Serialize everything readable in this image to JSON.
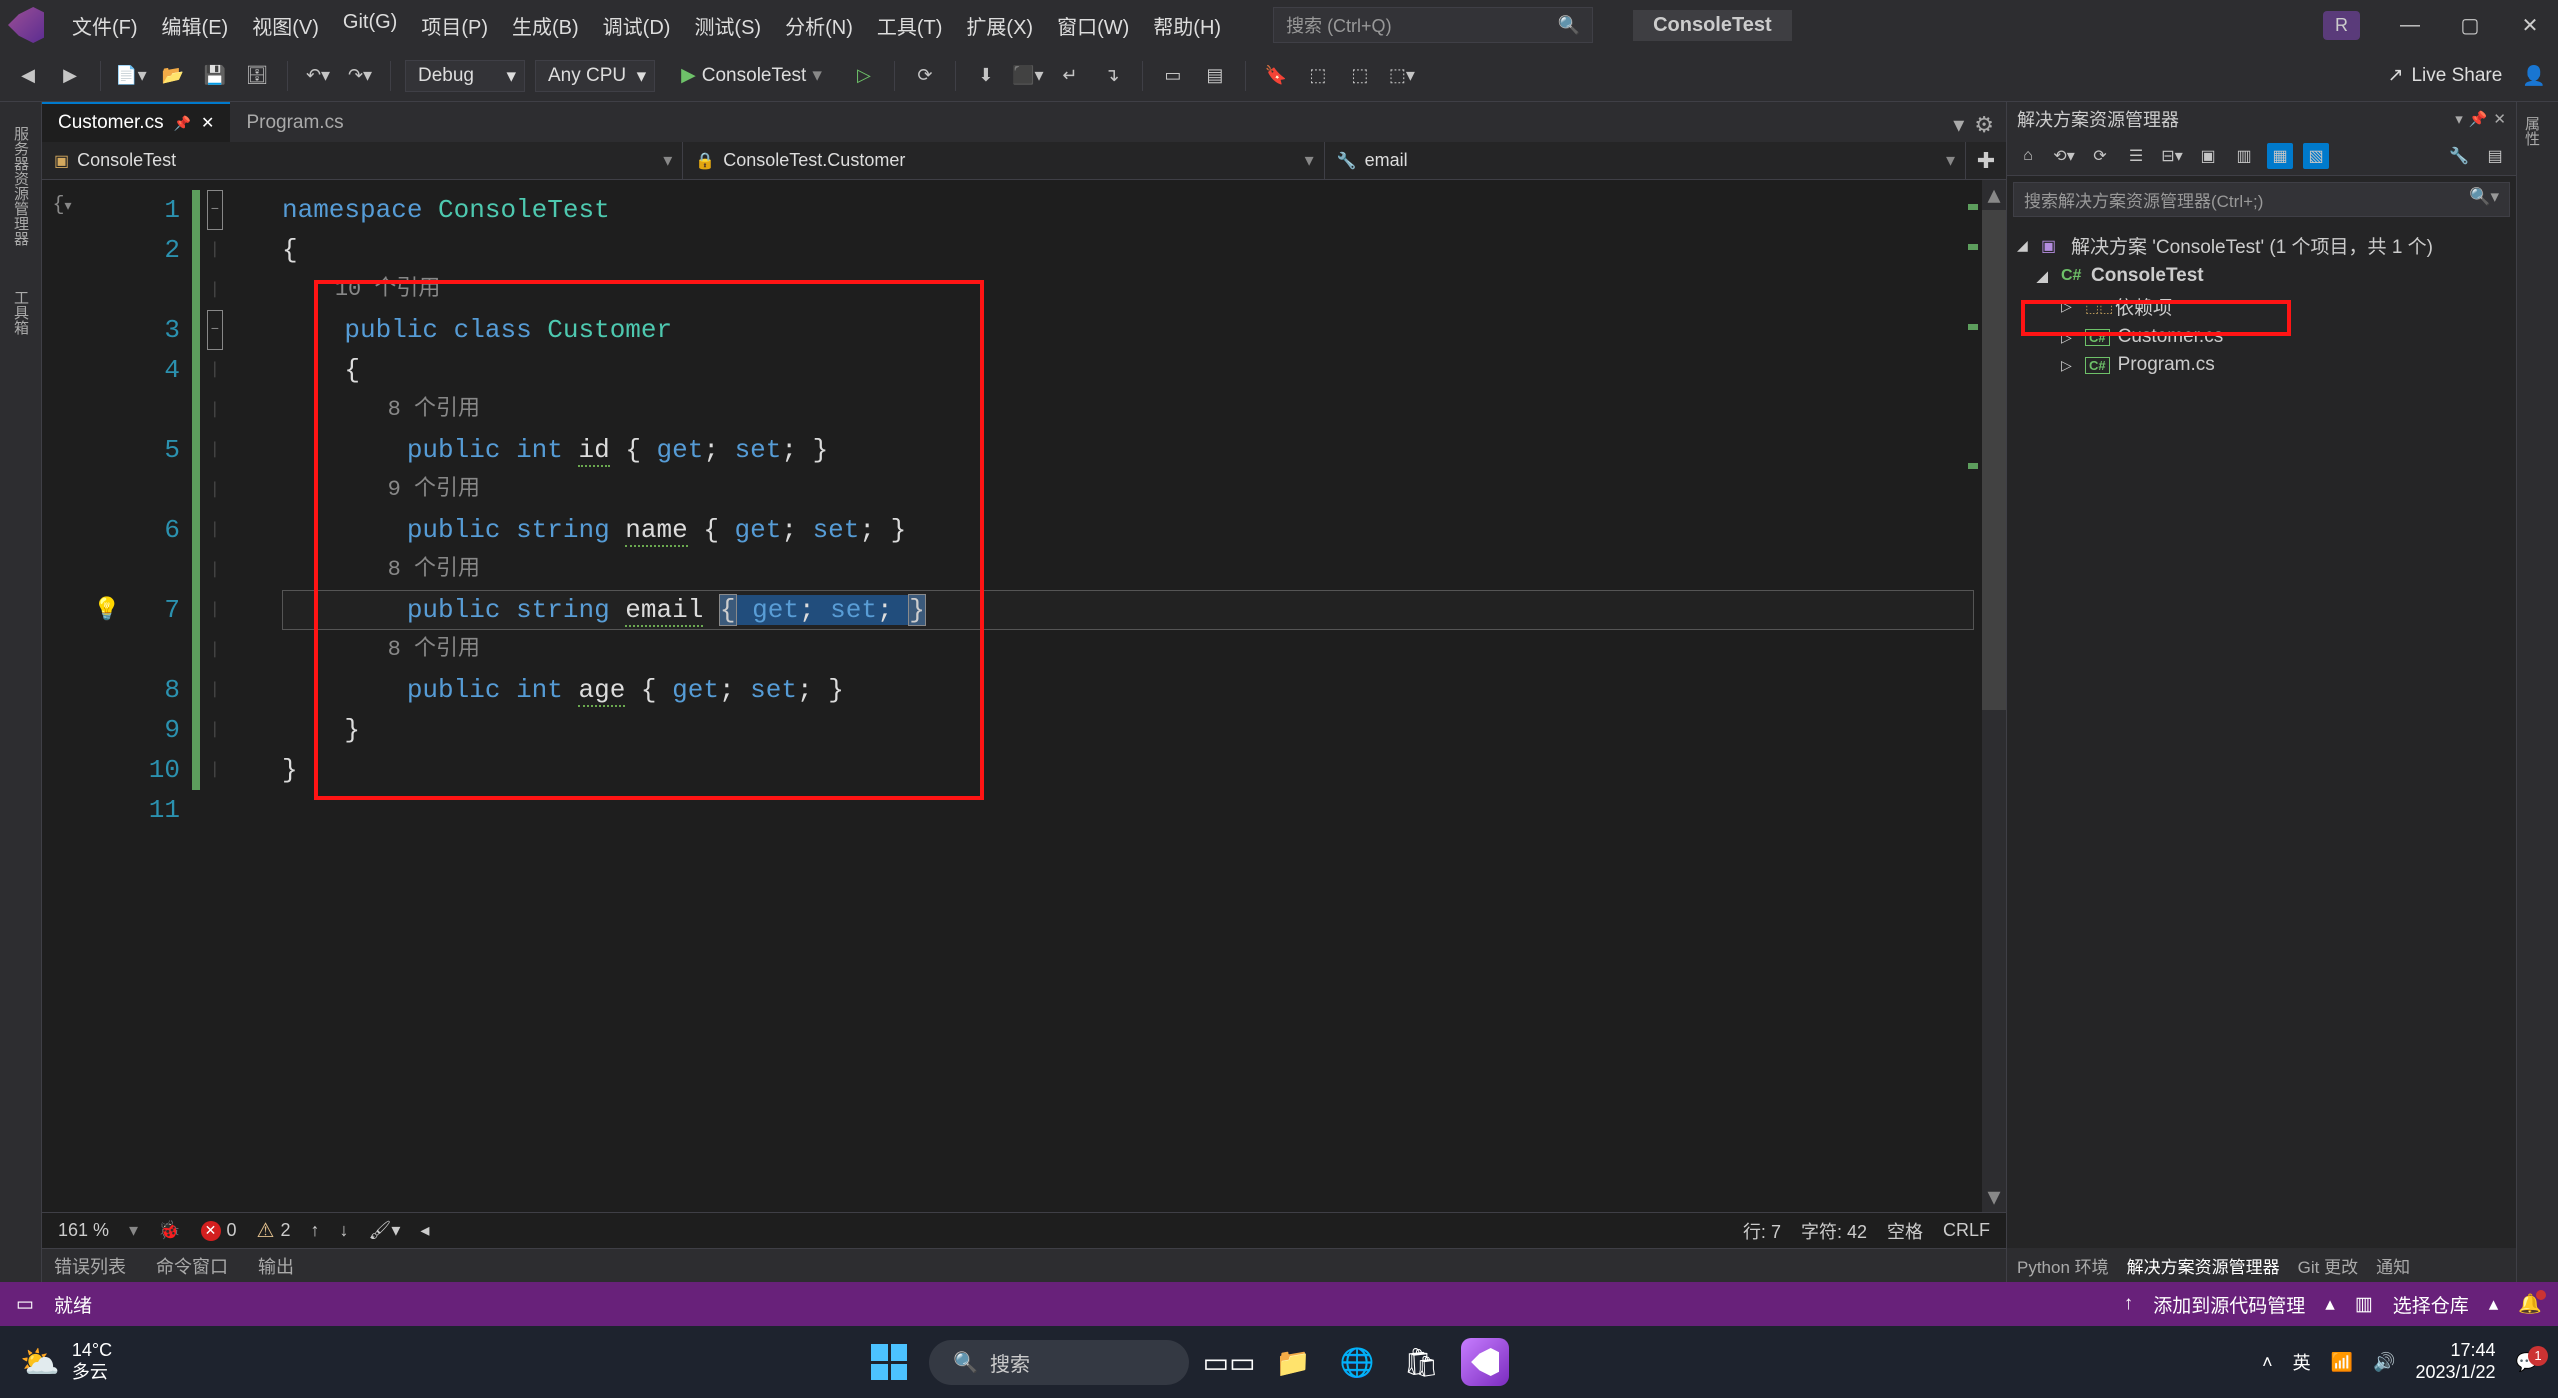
{
  "menu": [
    "文件(F)",
    "编辑(E)",
    "视图(V)",
    "Git(G)",
    "项目(P)",
    "生成(B)",
    "调试(D)",
    "测试(S)",
    "分析(N)",
    "工具(T)",
    "扩展(X)",
    "窗口(W)",
    "帮助(H)"
  ],
  "search_placeholder": "搜索 (Ctrl+Q)",
  "solution_name": "ConsoleTest",
  "user_initial": "R",
  "toolbar": {
    "config": "Debug",
    "platform": "Any CPU",
    "run_target": "ConsoleTest"
  },
  "liveshare": "Live Share",
  "tabs": [
    {
      "label": "Customer.cs",
      "active": true,
      "pinned": true
    },
    {
      "label": "Program.cs",
      "active": false
    }
  ],
  "nav": {
    "project": "ConsoleTest",
    "class": "ConsoleTest.Customer",
    "member": "email"
  },
  "code": {
    "namespace": "namespace",
    "ns_name": "ConsoleTest",
    "class_kw": "public class",
    "class_name": "Customer",
    "refs10": "10 个引用",
    "refs8": "8 个引用",
    "refs9": "9 个引用",
    "prop_public": "public",
    "type_int": "int",
    "type_string": "string",
    "id": "id",
    "name": "name",
    "email": "email",
    "age": "age",
    "get": "get",
    "set": "set"
  },
  "line_numbers": [
    "1",
    "2",
    "",
    "3",
    "4",
    "",
    "5",
    "",
    "6",
    "",
    "7",
    "",
    "8",
    "9",
    "10",
    "11"
  ],
  "status_strip": {
    "zoom": "161 %",
    "errors": "0",
    "warnings": "2",
    "line": "行: 7",
    "col": "字符: 42",
    "spaces": "空格",
    "crlf": "CRLF"
  },
  "output_tabs": [
    "错误列表",
    "命令窗口",
    "输出"
  ],
  "statusbar": {
    "state": "就绪",
    "scm": "添加到源代码管理",
    "repo": "选择仓库"
  },
  "explorer": {
    "title": "解决方案资源管理器",
    "search": "搜索解决方案资源管理器(Ctrl+;)",
    "solution": "解决方案 'ConsoleTest' (1 个项目，共 1 个)",
    "project": "ConsoleTest",
    "deps": "依赖项",
    "file1": "Customer.cs",
    "file2": "Program.cs",
    "tabs": [
      "Python 环境",
      "解决方案资源管理器",
      "Git 更改",
      "通知"
    ]
  },
  "side_panels": {
    "left1": "服务器资源管理器",
    "left2": "工具箱",
    "right1": "属性"
  },
  "taskbar": {
    "temp": "14°C",
    "weather": "多云",
    "search": "搜索",
    "ime": "英",
    "time": "17:44",
    "date": "2023/1/22",
    "notif": "1"
  }
}
